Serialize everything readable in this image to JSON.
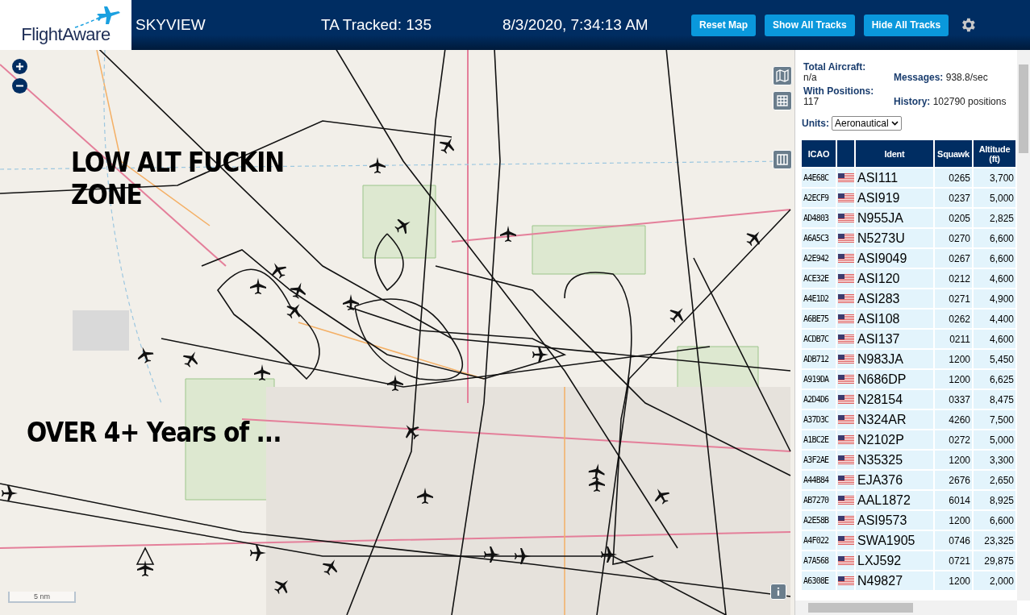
{
  "header": {
    "logo": "FlightAware",
    "title": "SKYVIEW",
    "tracked": "TA Tracked: 135",
    "datetime": "8/3/2020, 7:34:13 AM",
    "buttons": [
      "Reset Map",
      "Show All Tracks",
      "Hide All Tracks"
    ]
  },
  "map": {
    "annotations": [
      "LOW ALT FUCKIN ZONE",
      "OVER 4+ Years of ..."
    ],
    "scale": "5 nm"
  },
  "stats": [
    {
      "label": "Total Aircraft:",
      "value": "n/a"
    },
    {
      "label": "Messages:",
      "value": "938.8/sec"
    },
    {
      "label": "With Positions:",
      "value": "117"
    },
    {
      "label": "History:",
      "value": "102790 positions"
    }
  ],
  "units": {
    "label": "Units:",
    "value": "Aeronautical"
  },
  "table": {
    "columns": [
      "ICAO",
      "",
      "Ident",
      "Squawk",
      "Altitude (ft)"
    ],
    "rows": [
      {
        "icao": "A4E68C",
        "ident": "ASI111",
        "squawk": "0265",
        "altitude": "3,700"
      },
      {
        "icao": "A2ECF9",
        "ident": "ASI919",
        "squawk": "0237",
        "altitude": "5,000"
      },
      {
        "icao": "AD4803",
        "ident": "N955JA",
        "squawk": "0205",
        "altitude": "2,825"
      },
      {
        "icao": "A6A5C3",
        "ident": "N5273U",
        "squawk": "0270",
        "altitude": "6,600"
      },
      {
        "icao": "A2E942",
        "ident": "ASI9049",
        "squawk": "0267",
        "altitude": "6,600"
      },
      {
        "icao": "ACE32E",
        "ident": "ASI120",
        "squawk": "0212",
        "altitude": "4,600"
      },
      {
        "icao": "A4E1D2",
        "ident": "ASI283",
        "squawk": "0271",
        "altitude": "4,900"
      },
      {
        "icao": "A6BE75",
        "ident": "ASI108",
        "squawk": "0262",
        "altitude": "4,400"
      },
      {
        "icao": "ACDB7C",
        "ident": "ASI137",
        "squawk": "0211",
        "altitude": "4,600"
      },
      {
        "icao": "ADB712",
        "ident": "N983JA",
        "squawk": "1200",
        "altitude": "5,450"
      },
      {
        "icao": "A919DA",
        "ident": "N686DP",
        "squawk": "1200",
        "altitude": "6,625"
      },
      {
        "icao": "A2D4D6",
        "ident": "N28154",
        "squawk": "0337",
        "altitude": "8,475"
      },
      {
        "icao": "A37D3C",
        "ident": "N324AR",
        "squawk": "4260",
        "altitude": "7,500"
      },
      {
        "icao": "A1BC2E",
        "ident": "N2102P",
        "squawk": "0272",
        "altitude": "5,000"
      },
      {
        "icao": "A3F2AE",
        "ident": "N35325",
        "squawk": "1200",
        "altitude": "3,300"
      },
      {
        "icao": "A44B84",
        "ident": "EJA376",
        "squawk": "2676",
        "altitude": "2,650"
      },
      {
        "icao": "AB7270",
        "ident": "AAL1872",
        "squawk": "6014",
        "altitude": "8,925"
      },
      {
        "icao": "A2E58B",
        "ident": "ASI9573",
        "squawk": "1200",
        "altitude": "6,600"
      },
      {
        "icao": "A4F022",
        "ident": "SWA1905",
        "squawk": "0746",
        "altitude": "23,325"
      },
      {
        "icao": "A7A568",
        "ident": "LXJ592",
        "squawk": "0721",
        "altitude": "29,875"
      },
      {
        "icao": "A6308E",
        "ident": "N49827",
        "squawk": "1200",
        "altitude": "2,000"
      }
    ]
  }
}
